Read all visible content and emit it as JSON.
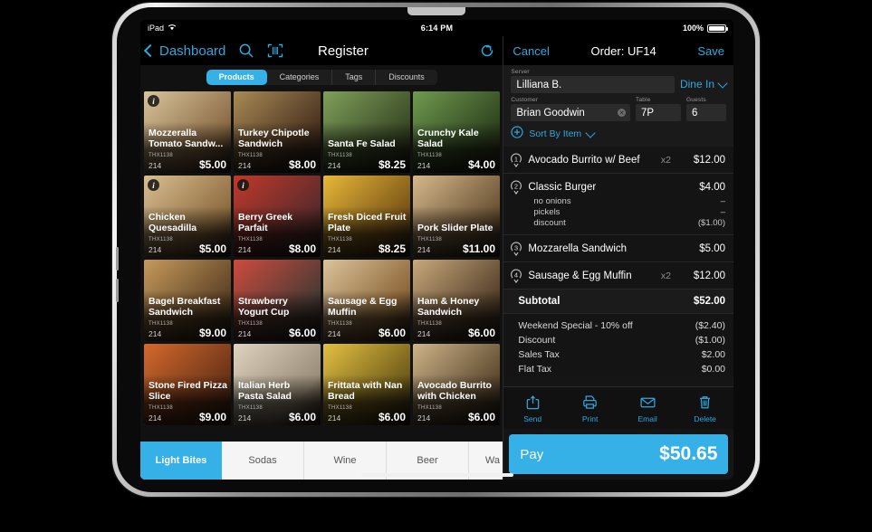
{
  "status_bar": {
    "device": "iPad",
    "wifi_icon": "wifi-icon",
    "time": "6:14 PM",
    "battery_percent": "100%"
  },
  "left_panel": {
    "nav": {
      "back_label": "Dashboard",
      "search_icon": "search-icon",
      "scan_icon": "barcode-scan-icon",
      "title": "Register",
      "refresh_icon": "refresh-icon"
    },
    "segments": [
      {
        "label": "Products",
        "active": true
      },
      {
        "label": "Categories",
        "active": false
      },
      {
        "label": "Tags",
        "active": false
      },
      {
        "label": "Discounts",
        "active": false
      }
    ],
    "products": [
      {
        "name": "Mozzeralla Tomato Sandw...",
        "sku": "THX1138",
        "qty": "214",
        "price": "$5.00",
        "info": true,
        "c1": "#d8c49a",
        "c2": "#8a6a44"
      },
      {
        "name": "Turkey Chipotle Sandwich",
        "sku": "THX1138",
        "qty": "214",
        "price": "$8.00",
        "info": false,
        "c1": "#a88b55",
        "c2": "#4a3220"
      },
      {
        "name": "Santa Fe Salad",
        "sku": "THX1138",
        "qty": "214",
        "price": "$8.25",
        "info": false,
        "c1": "#7fa05a",
        "c2": "#3a4a26"
      },
      {
        "name": "Crunchy Kale Salad",
        "sku": "THX1138",
        "qty": "214",
        "price": "$4.00",
        "info": false,
        "c1": "#6f9a4e",
        "c2": "#2f4420"
      },
      {
        "name": "Chicken Quesadilla",
        "sku": "THX1138",
        "qty": "214",
        "price": "$5.00",
        "info": true,
        "c1": "#d9bf92",
        "c2": "#8d6b3e"
      },
      {
        "name": "Berry Greek Parfait",
        "sku": "THX1138",
        "qty": "214",
        "price": "$8.00",
        "info": true,
        "c1": "#c0392b",
        "c2": "#5a2b2b"
      },
      {
        "name": "Fresh Diced Fruit Plate",
        "sku": "THX1138",
        "qty": "214",
        "price": "$8.25",
        "info": false,
        "c1": "#e8b838",
        "c2": "#7a5418"
      },
      {
        "name": "Pork Slider Plate",
        "sku": "THX1138",
        "qty": "214",
        "price": "$11.00",
        "info": false,
        "c1": "#d5b88c",
        "c2": "#6b5334"
      },
      {
        "name": "Bagel Breakfast Sandwich",
        "sku": "THX1138",
        "qty": "214",
        "price": "$9.00",
        "info": false,
        "c1": "#c69a5c",
        "c2": "#5e4326"
      },
      {
        "name": "Strawberry Yogurt Cup",
        "sku": "THX1138",
        "qty": "214",
        "price": "$6.00",
        "info": false,
        "c1": "#cf4a3e",
        "c2": "#4a3b34"
      },
      {
        "name": "Sausage & Egg Muffin",
        "sku": "THX1138",
        "qty": "214",
        "price": "$6.00",
        "info": false,
        "c1": "#dcc49b",
        "c2": "#8a6437"
      },
      {
        "name": "Ham & Honey Sandwich",
        "sku": "THX1138",
        "qty": "214",
        "price": "$6.00",
        "info": false,
        "c1": "#c9a97c",
        "c2": "#57422c"
      },
      {
        "name": "Stone Fired Pizza Slice",
        "sku": "THX1138",
        "qty": "214",
        "price": "$9.00",
        "info": false,
        "c1": "#d4692c",
        "c2": "#6a3318"
      },
      {
        "name": "Italian Herb Pasta Salad",
        "sku": "THX1138",
        "qty": "214",
        "price": "$6.00",
        "info": false,
        "c1": "#ded3c0",
        "c2": "#9a8d78"
      },
      {
        "name": "Frittata with Nan Bread",
        "sku": "THX1138",
        "qty": "214",
        "price": "$6.00",
        "info": false,
        "c1": "#e3c042",
        "c2": "#6e5a1a"
      },
      {
        "name": "Avocado Burrito with Chicken",
        "sku": "THX1138",
        "qty": "214",
        "price": "$6.00",
        "info": false,
        "c1": "#cfb489",
        "c2": "#5d4a30"
      }
    ],
    "categories": [
      {
        "label": "Light Bites",
        "active": true
      },
      {
        "label": "Sodas",
        "active": false
      },
      {
        "label": "Wine",
        "active": false
      },
      {
        "label": "Beer",
        "active": false
      },
      {
        "label": "Wa",
        "active": false
      }
    ]
  },
  "right_panel": {
    "nav": {
      "cancel_label": "Cancel",
      "order_title": "Order: UF14",
      "save_label": "Save"
    },
    "form": {
      "server_label": "Server",
      "server_value": "Lilliana B.",
      "dine_in_label": "Dine In",
      "customer_label": "Customer",
      "customer_value": "Brian Goodwin",
      "table_label": "Table",
      "table_value": "7P",
      "guests_label": "Guests",
      "guests_value": "6",
      "sort_label": "Sort By Item",
      "add_icon": "add-pin-icon"
    },
    "order_items": [
      {
        "num": "1",
        "name": "Avocado Burrito w/ Beef",
        "qty": "x2",
        "price": "$12.00",
        "mods": []
      },
      {
        "num": "2",
        "name": "Classic Burger",
        "qty": "",
        "price": "$4.00",
        "mods": [
          {
            "name": "no onions",
            "value": "–"
          },
          {
            "name": "pickels",
            "value": "–"
          },
          {
            "name": "discount",
            "value": "($1.00)"
          }
        ]
      },
      {
        "num": "3",
        "name": "Mozzarella Sandwich",
        "qty": "",
        "price": "$5.00",
        "mods": []
      },
      {
        "num": "4",
        "name": "Sausage & Egg Muffin",
        "qty": "x2",
        "price": "$12.00",
        "mods": []
      }
    ],
    "subtotal": {
      "label": "Subtotal",
      "value": "$52.00"
    },
    "totals": [
      {
        "label": "Weekend Special - 10% off",
        "value": "($2.40)"
      },
      {
        "label": "Discount",
        "value": "($1.00)"
      },
      {
        "label": "Sales Tax",
        "value": "$2.00"
      },
      {
        "label": "Flat Tax",
        "value": "$0.00"
      }
    ],
    "actions": [
      {
        "label": "Send",
        "icon": "send-icon"
      },
      {
        "label": "Print",
        "icon": "printer-icon"
      },
      {
        "label": "Email",
        "icon": "envelope-icon"
      },
      {
        "label": "Delete",
        "icon": "trash-icon"
      }
    ],
    "pay": {
      "label": "Pay",
      "amount": "$50.65"
    }
  },
  "colors": {
    "accent": "#35b1e8",
    "link": "#2fa8e0",
    "panel_bg": "#141414",
    "screen_bg": "#111111"
  }
}
